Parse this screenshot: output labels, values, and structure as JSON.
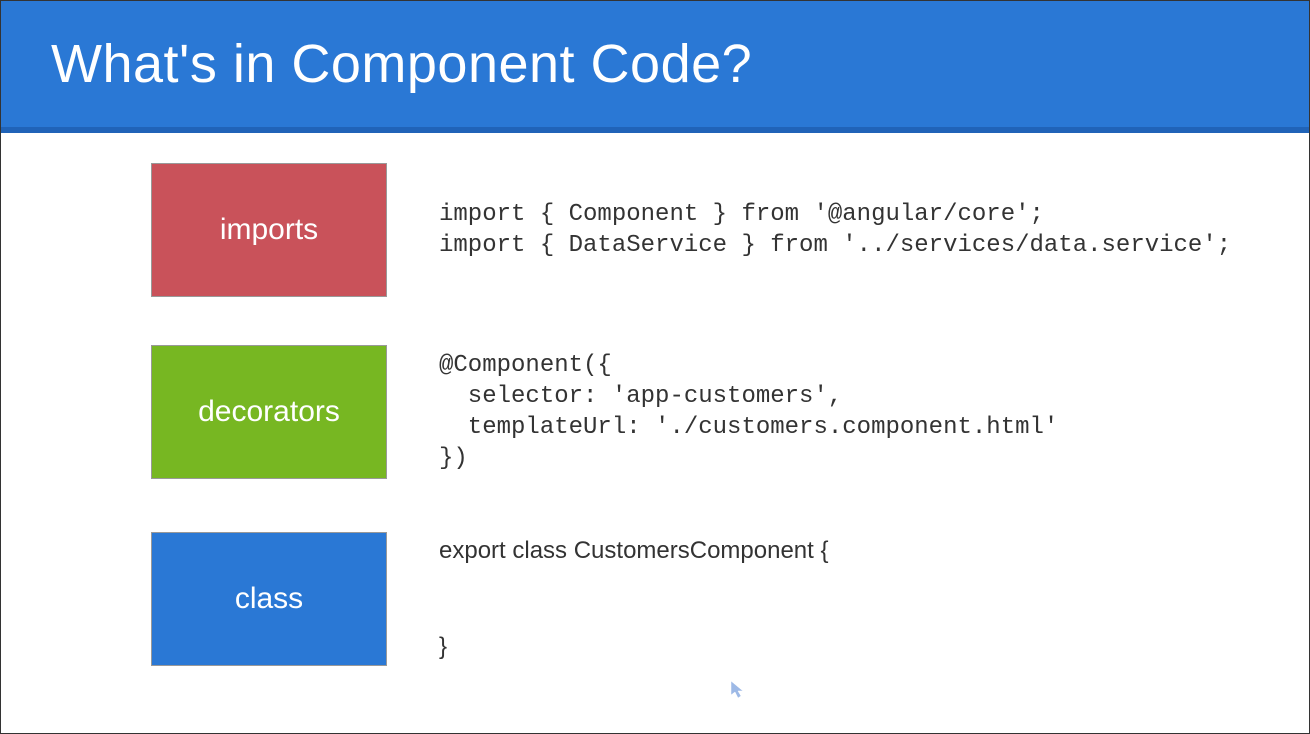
{
  "header": {
    "title": "What's in Component Code?"
  },
  "sections": {
    "imports": {
      "label": "imports",
      "code": "import { Component } from '@angular/core';\nimport { DataService } from '../services/data.service';"
    },
    "decorators": {
      "label": "decorators",
      "code": "@Component({\n  selector: 'app-customers',\n  templateUrl: './customers.component.html'\n})"
    },
    "class": {
      "label": "class",
      "code": "export class CustomersComponent {\n\n}"
    }
  },
  "colors": {
    "headerBg": "#2a78d5",
    "headerBorder": "#2063b8",
    "red": "#c9525a",
    "green": "#77b722",
    "blue": "#2a78d5"
  }
}
